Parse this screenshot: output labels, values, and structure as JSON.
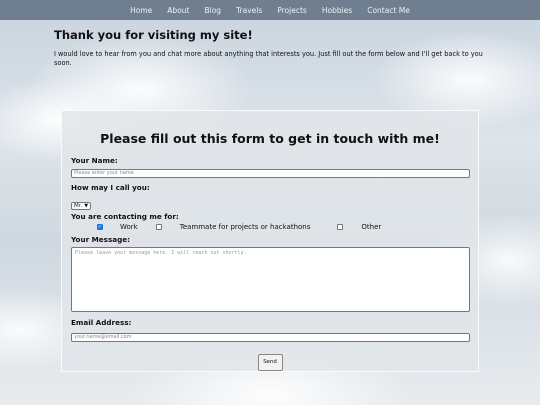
{
  "nav": {
    "items": [
      "Home",
      "About",
      "Blog",
      "Travels",
      "Projects",
      "Hobbies",
      "Contact Me"
    ]
  },
  "intro": {
    "heading": "Thank you for visiting my site!",
    "text": "I would love to hear from you and chat more about anything that interests you. Just fill out the form below and I'll get back to you soon."
  },
  "form": {
    "title": "Please fill out this form to get in touch with me!",
    "name_label": "Your Name:",
    "name_placeholder": "Please enter your name",
    "call_label": "How may I call you:",
    "call_value": "Mr.",
    "contact_label": "You are contacting me for:",
    "options": [
      {
        "label": "Work",
        "checked": true
      },
      {
        "label": "Teammate for projects or hackathons",
        "checked": false
      },
      {
        "label": "Other",
        "checked": false
      }
    ],
    "message_label": "Your Message:",
    "message_placeholder": "Please leave your message here. I will reach out shortly.",
    "email_label": "Email Address:",
    "email_placeholder": "your.name@email.com",
    "send_label": "Send"
  },
  "colors": {
    "navbar": "#6f7f8f",
    "checkbox_checked": "#1a73e8"
  }
}
